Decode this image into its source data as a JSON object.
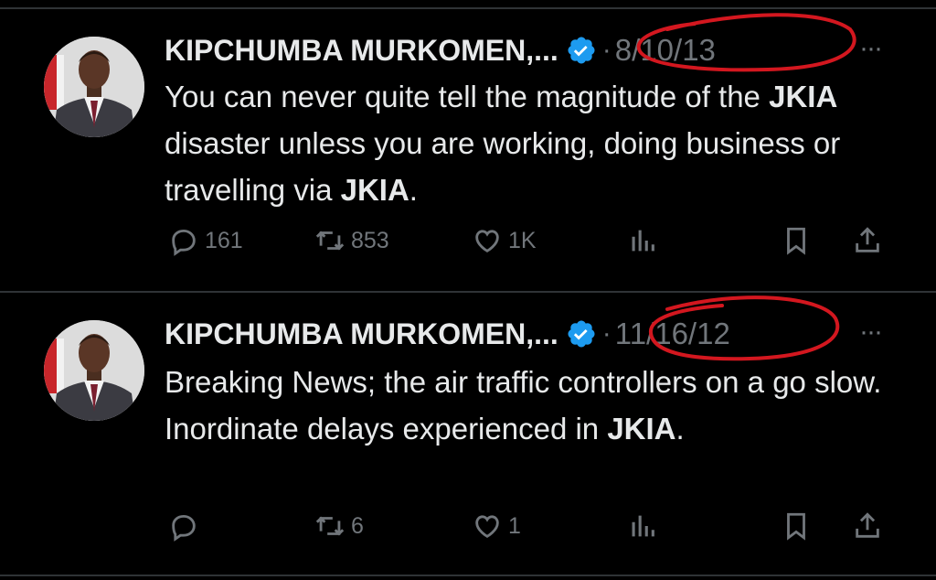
{
  "tweets": [
    {
      "name": "KIPCHUMBA MURKOMEN,...",
      "date": "8/10/13",
      "text_parts": [
        {
          "t": "You can never quite tell the magnitude of the ",
          "b": false
        },
        {
          "t": "JKIA",
          "b": true
        },
        {
          "t": " disaster unless you are working, doing business or travelling via ",
          "b": false
        },
        {
          "t": "JKIA",
          "b": true
        },
        {
          "t": ".",
          "b": false
        }
      ],
      "replies": "161",
      "reposts": "853",
      "likes": "1K"
    },
    {
      "name": "KIPCHUMBA MURKOMEN,...",
      "date": "11/16/12",
      "text_parts": [
        {
          "t": "Breaking News; the air traffic controllers on a go slow. Inordinate delays experienced in ",
          "b": false
        },
        {
          "t": "JKIA",
          "b": true
        },
        {
          "t": ".",
          "b": false
        }
      ],
      "replies": "",
      "reposts": "6",
      "likes": "1"
    }
  ],
  "separator": "·",
  "more_glyph": "···",
  "colors": {
    "background": "#000000",
    "text": "#e7e9ea",
    "muted": "#71767b",
    "verified": "#1d9bf0",
    "annotation": "#d3171f"
  },
  "icons": [
    "verified-badge-icon",
    "reply-icon",
    "repost-icon",
    "like-icon",
    "views-icon",
    "bookmark-icon",
    "share-icon",
    "more-icon"
  ]
}
